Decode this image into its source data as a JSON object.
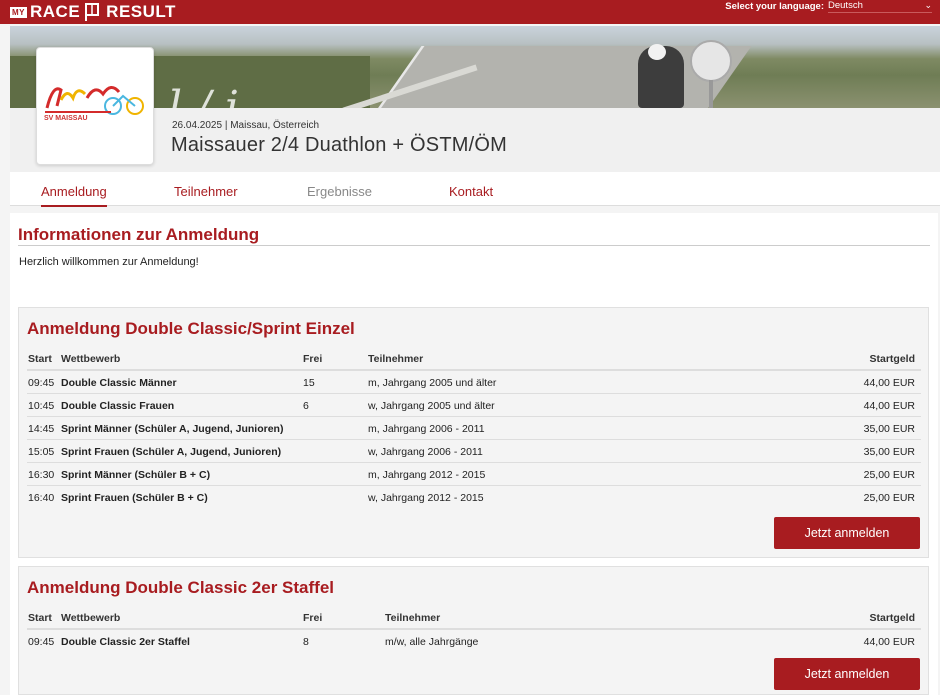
{
  "brand": {
    "my": "MY",
    "race": "RACE",
    "result": "RESULT"
  },
  "language": {
    "label": "Select your language:",
    "value": "Deutsch"
  },
  "club": {
    "logo_text": "SV MAISSAU"
  },
  "event": {
    "date_location": "26.04.2025 | Maissau, Österreich",
    "title": "Maissauer 2/4 Duathlon + ÖSTM/ÖM"
  },
  "tabs": [
    {
      "label": "Anmeldung",
      "state": "active"
    },
    {
      "label": "Teilnehmer",
      "state": "normal"
    },
    {
      "label": "Ergebnisse",
      "state": "disabled"
    },
    {
      "label": "Kontakt",
      "state": "normal"
    }
  ],
  "info": {
    "title": "Informationen zur Anmeldung",
    "text": "Herzlich willkommen zur Anmeldung!"
  },
  "panels": [
    {
      "title": "Anmeldung Double Classic/Sprint Einzel",
      "headers": {
        "start": "Start",
        "wettbewerb": "Wettbewerb",
        "frei": "Frei",
        "teilnehmer": "Teilnehmer",
        "startgeld": "Startgeld"
      },
      "rows": [
        {
          "start": "09:45",
          "wettbewerb": "Double Classic Männer",
          "frei": "15",
          "teilnehmer": "m, Jahrgang 2005 und älter",
          "startgeld": "44,00 EUR"
        },
        {
          "start": "10:45",
          "wettbewerb": "Double Classic Frauen",
          "frei": "6",
          "teilnehmer": "w, Jahrgang 2005 und älter",
          "startgeld": "44,00 EUR"
        },
        {
          "start": "14:45",
          "wettbewerb": "Sprint Männer (Schüler A, Jugend, Junioren)",
          "frei": "",
          "teilnehmer": "m, Jahrgang 2006 - 2011",
          "startgeld": "35,00 EUR"
        },
        {
          "start": "15:05",
          "wettbewerb": "Sprint Frauen (Schüler A, Jugend, Junioren)",
          "frei": "",
          "teilnehmer": "w, Jahrgang 2006 - 2011",
          "startgeld": "35,00 EUR"
        },
        {
          "start": "16:30",
          "wettbewerb": "Sprint Männer (Schüler B + C)",
          "frei": "",
          "teilnehmer": "m, Jahrgang 2012 - 2015",
          "startgeld": "25,00 EUR"
        },
        {
          "start": "16:40",
          "wettbewerb": "Sprint Frauen (Schüler B + C)",
          "frei": "",
          "teilnehmer": "w, Jahrgang 2012 - 2015",
          "startgeld": "25,00 EUR"
        }
      ],
      "button": "Jetzt anmelden"
    },
    {
      "title": "Anmeldung Double Classic 2er Staffel",
      "headers": {
        "start": "Start",
        "wettbewerb": "Wettbewerb",
        "frei": "Frei",
        "teilnehmer": "Teilnehmer",
        "startgeld": "Startgeld"
      },
      "rows": [
        {
          "start": "09:45",
          "wettbewerb": "Double Classic 2er Staffel",
          "frei": "8",
          "teilnehmer": "m/w, alle Jahrgänge",
          "startgeld": "44,00 EUR"
        }
      ],
      "button": "Jetzt anmelden"
    }
  ],
  "colors": {
    "accent": "#a81c20",
    "panel_bg": "#f4f4f4"
  }
}
